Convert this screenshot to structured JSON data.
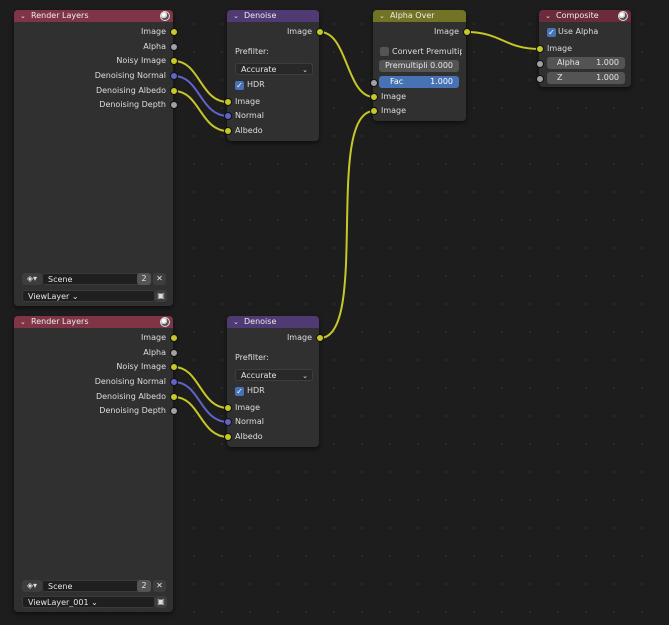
{
  "colors": {
    "background": "#1d1d1d",
    "node_body": "#303030",
    "render_layers_header": "#803546",
    "denoise_header": "#4f3a73",
    "alpha_over_header": "#737326",
    "composite_header": "#6b2c39",
    "socket_color": "#c7c729",
    "socket_float": "#a1a1a1",
    "socket_vector": "#6363c7",
    "accent_blue": "#4772b3"
  },
  "render_layers_1": {
    "title": "Render Layers",
    "outputs": [
      "Image",
      "Alpha",
      "Noisy Image",
      "Denoising Normal",
      "Denoising Albedo",
      "Denoising Depth"
    ],
    "scene_icon": "scene-icon",
    "scene": "Scene",
    "scene_users": "2",
    "close_glyph": "✕",
    "view_layer": "ViewLayer",
    "view_layer_icon": "render-layers-icon"
  },
  "render_layers_2": {
    "title": "Render Layers",
    "outputs": [
      "Image",
      "Alpha",
      "Noisy Image",
      "Denoising Normal",
      "Denoising Albedo",
      "Denoising Depth"
    ],
    "scene_icon": "scene-icon",
    "scene": "Scene",
    "scene_users": "2",
    "close_glyph": "✕",
    "view_layer": "ViewLayer_001",
    "view_layer_icon": "render-layers-icon"
  },
  "denoise_1": {
    "title": "Denoise",
    "output": "Image",
    "prefilter_label": "Prefilter:",
    "prefilter_value": "Accurate",
    "hdr_label": "HDR",
    "hdr_checked": true,
    "inputs": [
      "Image",
      "Normal",
      "Albedo"
    ]
  },
  "denoise_2": {
    "title": "Denoise",
    "output": "Image",
    "prefilter_label": "Prefilter:",
    "prefilter_value": "Accurate",
    "hdr_label": "HDR",
    "hdr_checked": true,
    "inputs": [
      "Image",
      "Normal",
      "Albedo"
    ]
  },
  "alpha_over": {
    "title": "Alpha Over",
    "output": "Image",
    "convert_label": "Convert Premultipl...",
    "convert_checked": false,
    "premul_label": "Premultipli",
    "premul_value": "0.000",
    "fac_label": "Fac",
    "fac_value": "1.000",
    "inputs": [
      "Image",
      "Image"
    ]
  },
  "composite": {
    "title": "Composite",
    "use_alpha_label": "Use Alpha",
    "use_alpha_checked": true,
    "input_image": "Image",
    "alpha_label": "Alpha",
    "alpha_value": "1.000",
    "z_label": "Z",
    "z_value": "1.000"
  }
}
